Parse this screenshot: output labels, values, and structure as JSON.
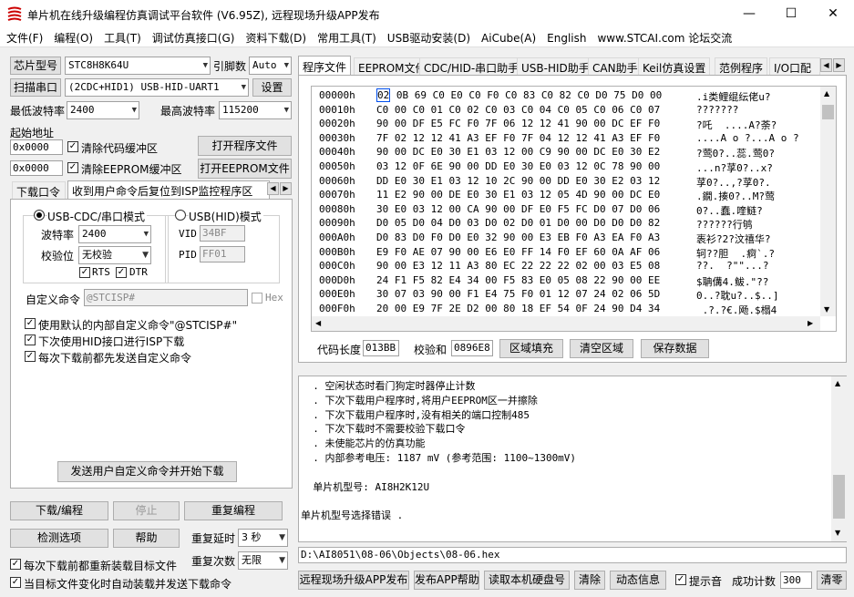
{
  "window": {
    "title": "单片机在线升级编程仿真调试平台软件 (V6.95Z), 远程现场升级APP发布",
    "min": "—",
    "max": "☐",
    "close": "✕"
  },
  "menu": [
    "文件(F)",
    "编程(O)",
    "工具(T)",
    "调试仿真接口(G)",
    "资料下载(D)",
    "常用工具(T)",
    "USB驱动安装(D)",
    "AiCube(A)",
    "English",
    "www.STCAI.com 论坛交流"
  ],
  "left": {
    "chip_label": "芯片型号",
    "chip_value": "STC8H8K64U",
    "pins_label": "引脚数",
    "pins_value": "Auto",
    "scan_label": "扫描串口",
    "port_value": "(2CDC+HID1) USB-HID-UART1",
    "settings_label": "设置",
    "min_baud_label": "最低波特率",
    "min_baud_value": "2400",
    "max_baud_label": "最高波特率",
    "max_baud_value": "115200",
    "start_addr_label": "起始地址",
    "addr1": "0x0000",
    "clear_code": "清除代码缓冲区",
    "open_prog": "打开程序文件",
    "addr2": "0x0000",
    "clear_eeprom": "清除EEPROM缓冲区",
    "open_eeprom": "打开EEPROM文件",
    "tabs": [
      "下载口令",
      "收到用户命令后复位到ISP监控程序区"
    ],
    "mode_cdc": "USB-CDC/串口模式",
    "mode_hid": "USB(HID)模式",
    "baud_label": "波特率",
    "baud_value": "2400",
    "parity_label": "校验位",
    "parity_value": "无校验",
    "rts": "RTS",
    "dtr": "DTR",
    "vid_label": "VID",
    "vid_value": "34BF",
    "pid_label": "PID",
    "pid_value": "FF01",
    "custom_cmd_label": "自定义命令",
    "custom_cmd_value": "@STCISP#",
    "hex_label": "Hex",
    "opt1": "使用默认的内部自定义命令\"@STCISP#\"",
    "opt2": "下次使用HID接口进行ISP下载",
    "opt3": "每次下载前都先发送自定义命令",
    "send_btn": "发送用户自定义命令并开始下载",
    "download": "下载/编程",
    "stop": "停止",
    "reprogram": "重复编程",
    "check": "检测选项",
    "help": "帮助",
    "repeat_delay_label": "重复延时",
    "repeat_delay_value": "3 秒",
    "repeat_count_label": "重复次数",
    "repeat_count_value": "无限",
    "reload1": "每次下载前都重新装载目标文件",
    "reload2": "当目标文件变化时自动装载并发送下载命令"
  },
  "right": {
    "tabs": [
      "程序文件",
      "EEPROM文件",
      "CDC/HID-串口助手",
      "USB-HID助手",
      "CAN助手",
      "Keil仿真设置",
      "范例程序",
      "I/O口配"
    ],
    "hex_rows": [
      {
        "addr": "00000h",
        "bytes": "02 0B 69 C0 E0 C0 F0 C0 83 C0 82 C0 D0 75 D0 00",
        "ascii": ".i类鲤绲纭佬u?"
      },
      {
        "addr": "00010h",
        "bytes": "C0 00 C0 01 C0 02 C0 03 C0 04 C0 05 C0 06 C0 07",
        "ascii": "???????"
      },
      {
        "addr": "00020h",
        "bytes": "90 00 DF E5 FC F0 7F 06 12 12 41 90 00 DC EF F0",
        "ascii": "?吒  ....A?荼?"
      },
      {
        "addr": "00030h",
        "bytes": "7F 02 12 12 41 A3 EF F0 7F 04 12 12 41 A3 EF F0",
        "ascii": "....A o ?...A o ?"
      },
      {
        "addr": "00040h",
        "bytes": "90 00 DC E0 30 E1 03 12 00 C9 90 00 DC E0 30 E2",
        "ascii": "?莺0?..蕊.莺0?"
      },
      {
        "addr": "00050h",
        "bytes": "03 12 0F 6E 90 00 DD E0 30 E0 03 12 0C 78 90 00",
        "ascii": "...n?莩0?..x?"
      },
      {
        "addr": "00060h",
        "bytes": "DD E0 30 E1 03 12 10 2C 90 00 DD E0 30 E2 03 12",
        "ascii": "莩0?..,?莩0?."
      },
      {
        "addr": "00070h",
        "bytes": "11 E2 90 00 DE E0 30 E1 03 12 05 4D 90 00 DC E0",
        "ascii": ".鐗.揍0?..M?莺"
      },
      {
        "addr": "00080h",
        "bytes": "30 E0 03 12 00 CA 90 00 DF E0 F5 FC D0 07 D0 06",
        "ascii": "0?..蠢.喹鲢?"
      },
      {
        "addr": "00090h",
        "bytes": "D0 05 D0 04 D0 03 D0 02 D0 01 D0 00 D0 D0 D0 82",
        "ascii": "??????行鸲"
      },
      {
        "addr": "000A0h",
        "bytes": "D0 83 D0 F0 D0 E0 32 90 00 E3 EB F0 A3 EA F0 A3",
        "ascii": "袠衫?2?汶禧华?"
      },
      {
        "addr": "000B0h",
        "bytes": "E9 F0 AE 07 90 00 E6 E0 FF 14 F0 EF 60 0A AF 06",
        "ascii": "轲??胆  .痾`.?"
      },
      {
        "addr": "000C0h",
        "bytes": "90 00 E3 12 11 A3 80 EC 22 22 22 02 00 03 E5 08",
        "ascii": "??.  ?\"\"...?"
      },
      {
        "addr": "000D0h",
        "bytes": "24 F1 F5 82 E4 34 00 F5 83 E0 05 08 22 90 00 EE",
        "ascii": "$聃傋4.鲅.\"??"
      },
      {
        "addr": "000E0h",
        "bytes": "30 07 03 90 00 F1 E4 75 F0 01 12 07 24 02 06 5D",
        "ascii": "0..?耽u?..$..]"
      },
      {
        "addr": "000F0h",
        "bytes": "20 00 E9 7F 2E D2 00 80 18 EF 54 0F 24 90 D4 34",
        "ascii": " .?.?€.飏.$榻4"
      }
    ],
    "code_len_label": "代码长度",
    "code_len_value": "013BB",
    "checksum_label": "校验和",
    "checksum_value": "0896E8",
    "fill_btn": "区域填充",
    "clear_btn": "清空区域",
    "save_btn": "保存数据",
    "log_lines": [
      "  . 空闲状态时看门狗定时器停止计数",
      "  . 下次下载用户程序时,将用户EEPROM区一并擦除",
      "  . 下次下载用户程序时,没有相关的端口控制485",
      "  . 下次下载时不需要校验下载口令",
      "  . 未使能芯片的仿真功能",
      "  . 内部参考电压: 1187 mV (参考范围: 1100~1300mV)",
      "",
      "  单片机型号: AI8H2K12U",
      "",
      "单片机型号选择错误 ."
    ],
    "path": "D:\\AI8051\\08-06\\Objects\\08-06.hex",
    "remote_btn": "远程现场升级APP发布",
    "publish_help": "发布APP帮助",
    "read_disk": "读取本机硬盘号",
    "clear": "清除",
    "anim": "动态信息",
    "beep": "提示音",
    "success_label": "成功计数",
    "success_value": "300",
    "reset": "清零"
  }
}
